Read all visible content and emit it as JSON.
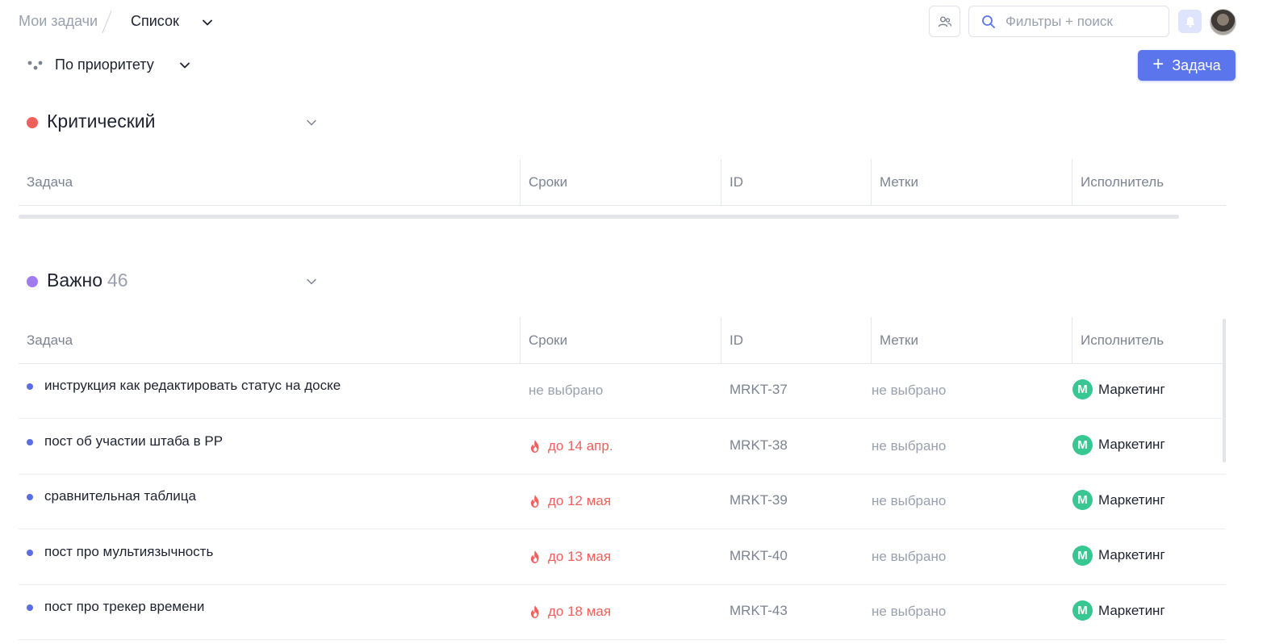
{
  "breadcrumb": {
    "root": "Мои задачи",
    "current": "Список"
  },
  "search": {
    "placeholder": "Фильтры + поиск",
    "value": ""
  },
  "grouping": {
    "label": "По приоритету"
  },
  "actions": {
    "add_task_label": "Задача",
    "add_task_plus": "+"
  },
  "colors": {
    "accent": "#5b75ec",
    "critical": "#f0605c",
    "important": "#a07cf0",
    "assignee": "#38c793",
    "overdue": "#f0605c"
  },
  "columns": [
    "Задача",
    "Сроки",
    "ID",
    "Метки",
    "Исполнитель"
  ],
  "sections": [
    {
      "title": "Критический",
      "count": "",
      "dot_color": "#f0605c",
      "tasks": []
    },
    {
      "title": "Важно",
      "count": "46",
      "dot_color": "#a07cf0",
      "tasks": [
        {
          "title": "инструкция как редактировать статус на доске",
          "due": "не выбрано",
          "overdue": false,
          "id": "MRKT-37",
          "tags": "не выбрано",
          "assignee_initial": "М",
          "assignee": "Маркетинг"
        },
        {
          "title": "пост об участии штаба в РР",
          "due": "до 14 апр.",
          "overdue": true,
          "id": "MRKT-38",
          "tags": "не выбрано",
          "assignee_initial": "М",
          "assignee": "Маркетинг"
        },
        {
          "title": "сравнительная таблица",
          "due": "до 12 мая",
          "overdue": true,
          "id": "MRKT-39",
          "tags": "не выбрано",
          "assignee_initial": "М",
          "assignee": "Маркетинг"
        },
        {
          "title": "пост про мультиязычность",
          "due": "до 13 мая",
          "overdue": true,
          "id": "MRKT-40",
          "tags": "не выбрано",
          "assignee_initial": "М",
          "assignee": "Маркетинг"
        },
        {
          "title": "пост про трекер времени",
          "due": "до 18 мая",
          "overdue": true,
          "id": "MRKT-43",
          "tags": "не выбрано",
          "assignee_initial": "М",
          "assignee": "Маркетинг"
        }
      ]
    }
  ]
}
